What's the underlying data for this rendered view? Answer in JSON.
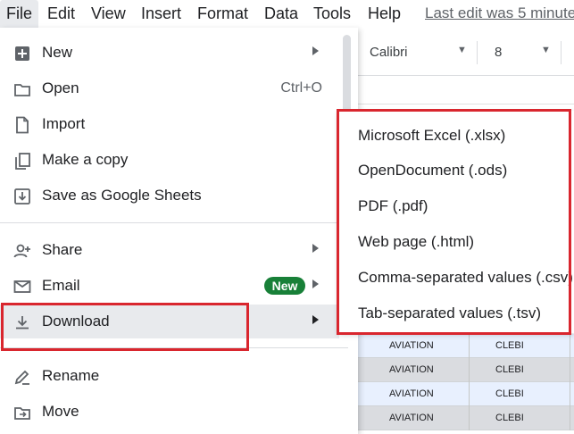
{
  "menubar": {
    "items": [
      "File",
      "Edit",
      "View",
      "Insert",
      "Format",
      "Data",
      "Tools",
      "Help"
    ],
    "last_edit": "Last edit was 5 minute"
  },
  "toolbar": {
    "font": "Calibri",
    "font_size": "8"
  },
  "file_menu": {
    "new": "New",
    "open": "Open",
    "open_shortcut": "Ctrl+O",
    "import": "Import",
    "make_copy": "Make a copy",
    "save_as": "Save as Google Sheets",
    "share": "Share",
    "email": "Email",
    "email_badge": "New",
    "download": "Download",
    "rename": "Rename",
    "move": "Move"
  },
  "download_menu": {
    "items": [
      "Microsoft Excel (.xlsx)",
      "OpenDocument (.ods)",
      "PDF (.pdf)",
      "Web page (.html)",
      "Comma-separated values (.csv)",
      "Tab-separated values (.tsv)"
    ]
  },
  "sheet_rows": [
    {
      "c1": "AVIATION",
      "c2": "CLEBI"
    },
    {
      "c1": "AVIATION",
      "c2": "CLEBI"
    },
    {
      "c1": "AVIATION",
      "c2": "CLEBI"
    },
    {
      "c1": "AVIATION",
      "c2": "CLEBI"
    }
  ],
  "colors": {
    "highlight": "#d9262e",
    "new_badge": "#188038",
    "row_selected": "#e8f0fe",
    "row_grey": "#dadce0"
  },
  "icons": {
    "new": "plus-box-icon",
    "open": "folder-icon",
    "import": "file-icon",
    "make_copy": "copy-icon",
    "save_as": "save-down-icon",
    "share": "person-add-icon",
    "email": "mail-icon",
    "download": "download-icon",
    "rename": "pencil-icon",
    "move": "folder-move-icon"
  }
}
